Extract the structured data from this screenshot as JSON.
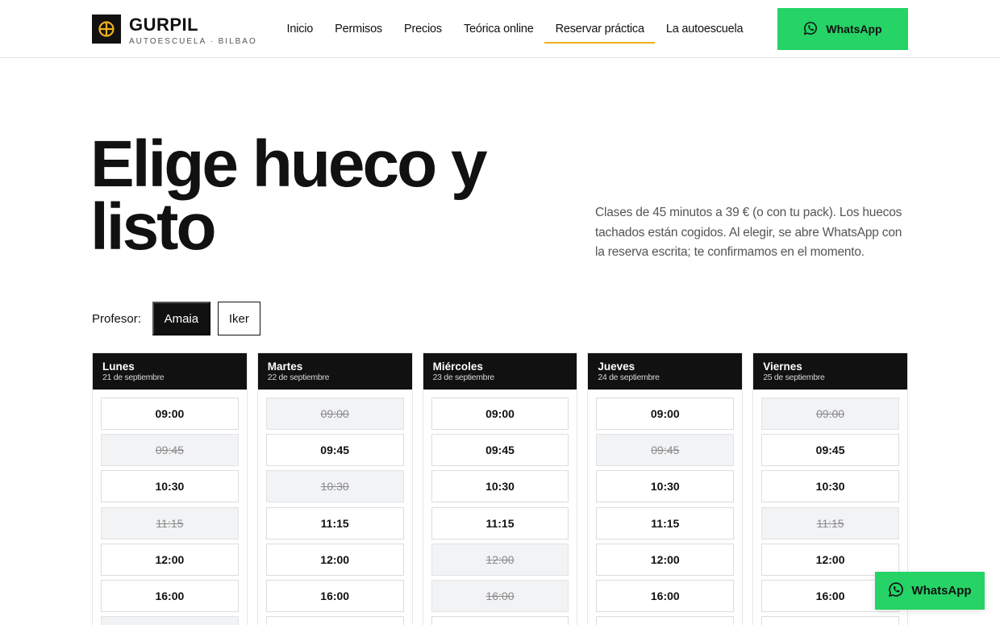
{
  "brand": {
    "name": "GURPIL",
    "tagline": "AUTOESCUELA · BILBAO",
    "accent": "#f2b01e"
  },
  "nav": {
    "items": [
      {
        "label": "Inicio",
        "active": false
      },
      {
        "label": "Permisos",
        "active": false
      },
      {
        "label": "Precios",
        "active": false
      },
      {
        "label": "Teórica online",
        "active": false
      },
      {
        "label": "Reservar práctica",
        "active": true
      },
      {
        "label": "La autoescuela",
        "active": false
      }
    ],
    "whatsapp_label": "WhatsApp",
    "whatsapp_color": "#25d366"
  },
  "hero": {
    "title": "Elige hueco y listo",
    "description": "Clases de 45 minutos a 39 € (o con tu pack). Los huecos tachados están cogidos. Al elegir, se abre WhatsApp con la reserva escrita; te confirmamos en el momento."
  },
  "teacher": {
    "label": "Profesor:",
    "options": [
      {
        "name": "Amaia",
        "selected": true
      },
      {
        "name": "Iker",
        "selected": false
      }
    ]
  },
  "schedule": {
    "days": [
      {
        "name": "Lunes",
        "date": "21 de septiembre",
        "slots": [
          {
            "time": "09:00",
            "taken": false
          },
          {
            "time": "09:45",
            "taken": true
          },
          {
            "time": "10:30",
            "taken": false
          },
          {
            "time": "11:15",
            "taken": true
          },
          {
            "time": "12:00",
            "taken": false
          },
          {
            "time": "16:00",
            "taken": false
          },
          {
            "time": "",
            "taken": true
          }
        ]
      },
      {
        "name": "Martes",
        "date": "22 de septiembre",
        "slots": [
          {
            "time": "09:00",
            "taken": true
          },
          {
            "time": "09:45",
            "taken": false
          },
          {
            "time": "10:30",
            "taken": true
          },
          {
            "time": "11:15",
            "taken": false
          },
          {
            "time": "12:00",
            "taken": false
          },
          {
            "time": "16:00",
            "taken": false
          },
          {
            "time": "",
            "taken": false
          }
        ]
      },
      {
        "name": "Miércoles",
        "date": "23 de septiembre",
        "slots": [
          {
            "time": "09:00",
            "taken": false
          },
          {
            "time": "09:45",
            "taken": false
          },
          {
            "time": "10:30",
            "taken": false
          },
          {
            "time": "11:15",
            "taken": false
          },
          {
            "time": "12:00",
            "taken": true
          },
          {
            "time": "16:00",
            "taken": true
          },
          {
            "time": "",
            "taken": false
          }
        ]
      },
      {
        "name": "Jueves",
        "date": "24 de septiembre",
        "slots": [
          {
            "time": "09:00",
            "taken": false
          },
          {
            "time": "09:45",
            "taken": true
          },
          {
            "time": "10:30",
            "taken": false
          },
          {
            "time": "11:15",
            "taken": false
          },
          {
            "time": "12:00",
            "taken": false
          },
          {
            "time": "16:00",
            "taken": false
          },
          {
            "time": "",
            "taken": false
          }
        ]
      },
      {
        "name": "Viernes",
        "date": "25 de septiembre",
        "slots": [
          {
            "time": "09:00",
            "taken": true
          },
          {
            "time": "09:45",
            "taken": false
          },
          {
            "time": "10:30",
            "taken": false
          },
          {
            "time": "11:15",
            "taken": true
          },
          {
            "time": "12:00",
            "taken": false
          },
          {
            "time": "16:00",
            "taken": false
          },
          {
            "time": "",
            "taken": false
          }
        ]
      }
    ]
  },
  "floating_whatsapp": {
    "label": "WhatsApp"
  }
}
